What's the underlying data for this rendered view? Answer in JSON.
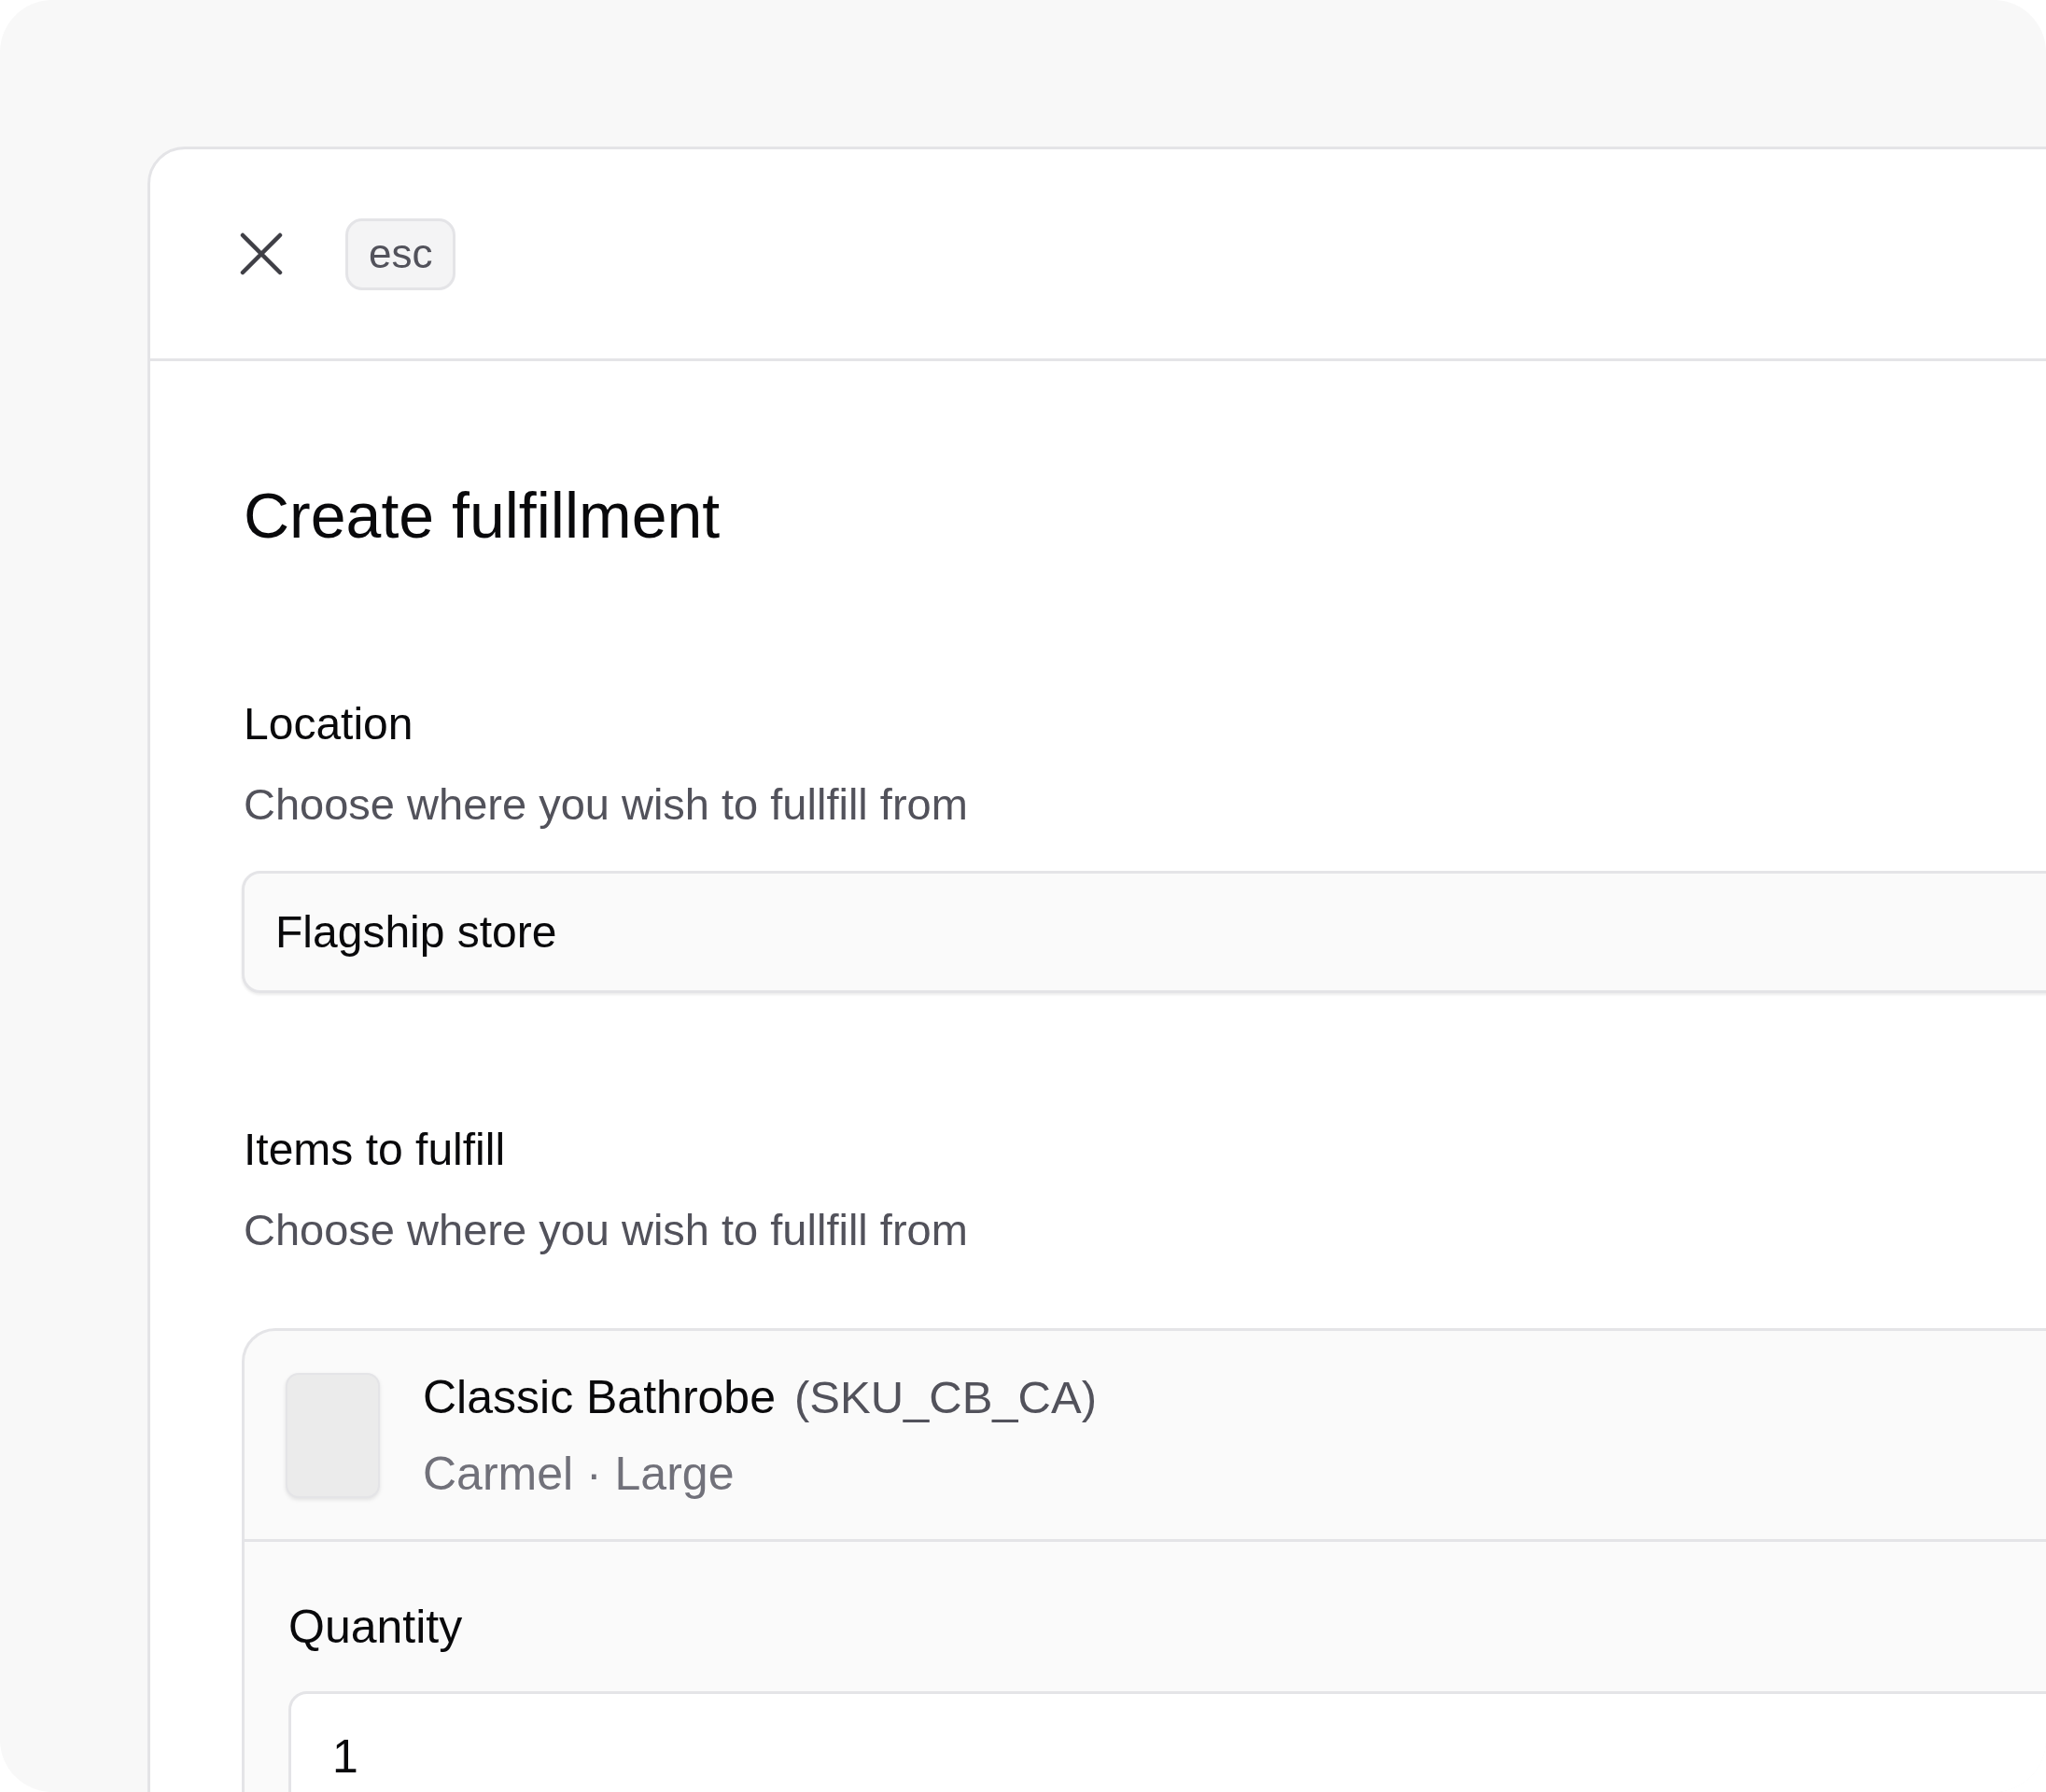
{
  "dialog": {
    "close_key": "esc",
    "title": "Create fulfillment"
  },
  "location": {
    "label": "Location",
    "description": "Choose where you wish to fullfill from",
    "value": "Flagship store"
  },
  "items": {
    "label": "Items to fulfill",
    "description": "Choose where you wish to fullfill from",
    "list": [
      {
        "name": "Classic Bathrobe",
        "sku": "(SKU_CB_CA)",
        "variant": "Carmel · Large",
        "quantity_label": "Quantity",
        "quantity": "1"
      }
    ]
  }
}
